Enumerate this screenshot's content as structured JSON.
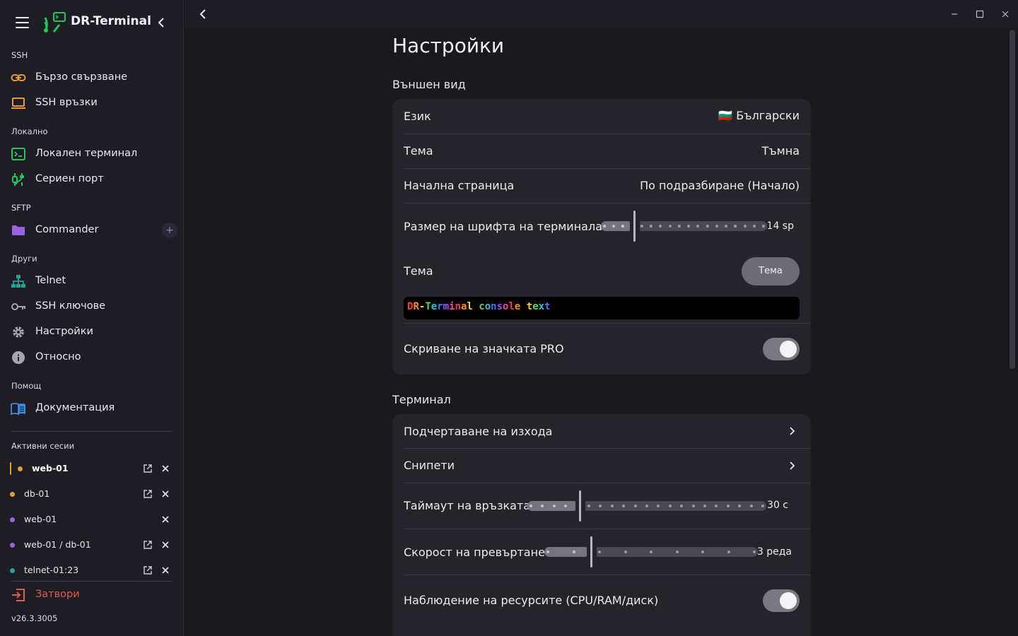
{
  "app": {
    "title": "DR-Terminal",
    "version": "v26.3.3005"
  },
  "sidebar": {
    "sections": [
      {
        "title": "SSH",
        "items": [
          {
            "label": "Бързо свързване",
            "icon": "link-icon"
          },
          {
            "label": "SSH връзки",
            "icon": "laptop-icon"
          }
        ]
      },
      {
        "title": "Локално",
        "items": [
          {
            "label": "Локален терминал",
            "icon": "terminal-icon"
          },
          {
            "label": "Сериен порт",
            "icon": "serial-port-icon"
          }
        ]
      },
      {
        "title": "SFTP",
        "items": [
          {
            "label": "Commander",
            "icon": "folder-icon",
            "add": "+"
          }
        ]
      },
      {
        "title": "Други",
        "items": [
          {
            "label": "Telnet",
            "icon": "network-icon"
          },
          {
            "label": "SSH ключове",
            "icon": "key-icon"
          },
          {
            "label": "Настройки",
            "icon": "gear-icon"
          },
          {
            "label": "Относно",
            "icon": "info-icon"
          }
        ]
      },
      {
        "title": "Помощ",
        "items": [
          {
            "label": "Документация",
            "icon": "book-icon"
          }
        ]
      }
    ],
    "sessions_title": "Активни сесии",
    "sessions": [
      {
        "name": "web-01",
        "color": "#e59b3a",
        "active": true,
        "detach": true
      },
      {
        "name": "db-01",
        "color": "#e59b3a",
        "active": false,
        "detach": true
      },
      {
        "name": "web-01",
        "color": "#9a62e0",
        "active": false,
        "detach": false
      },
      {
        "name": "web-01 / db-01",
        "color": "#9a62e0",
        "active": false,
        "detach": true
      },
      {
        "name": "telnet-01:23",
        "color": "#22a394",
        "active": false,
        "detach": true
      }
    ],
    "close_label": "Затвори"
  },
  "settings": {
    "title": "Настройки",
    "appearance": {
      "title": "Външен вид",
      "language_label": "Език",
      "language_value": "🇧🇬 Български",
      "theme_label": "Тема",
      "theme_value": "Тъмна",
      "start_page_label": "Начална страница",
      "start_page_value": "По подразбиране (Начало)",
      "font_size_label": "Размер на шрифта на терминала",
      "font_size_value": "14 sp",
      "font_size_fraction": 0.2,
      "console_theme_label": "Тема",
      "console_theme_button": "Тема",
      "console_preview": "DR-Terminal console text",
      "console_colors": [
        "#ff3b3b",
        "#ff8c1a",
        "#ffd21f",
        "#5ddc4a",
        "#2ec4d6",
        "#3a7bff",
        "#9b4dff",
        "#ff3fb0"
      ],
      "hide_pro_label": "Скриване на значката PRO",
      "hide_pro_on": true
    },
    "terminal": {
      "title": "Терминал",
      "highlight_label": "Подчертаване на изхода",
      "snippets_label": "Снипети",
      "timeout_label": "Таймаут на връзката",
      "timeout_value": "30 с",
      "timeout_fraction": 0.22,
      "scroll_label": "Скорост на превъртане",
      "scroll_value": "3 реда",
      "scroll_fraction": 0.22,
      "monitor_label": "Наблюдение на ресурсите (CPU/RAM/диск)",
      "monitor_on": true
    }
  },
  "colors": {
    "accent": "#8f7bd6",
    "danger": "#e05a52",
    "brand": "#22c55e"
  }
}
